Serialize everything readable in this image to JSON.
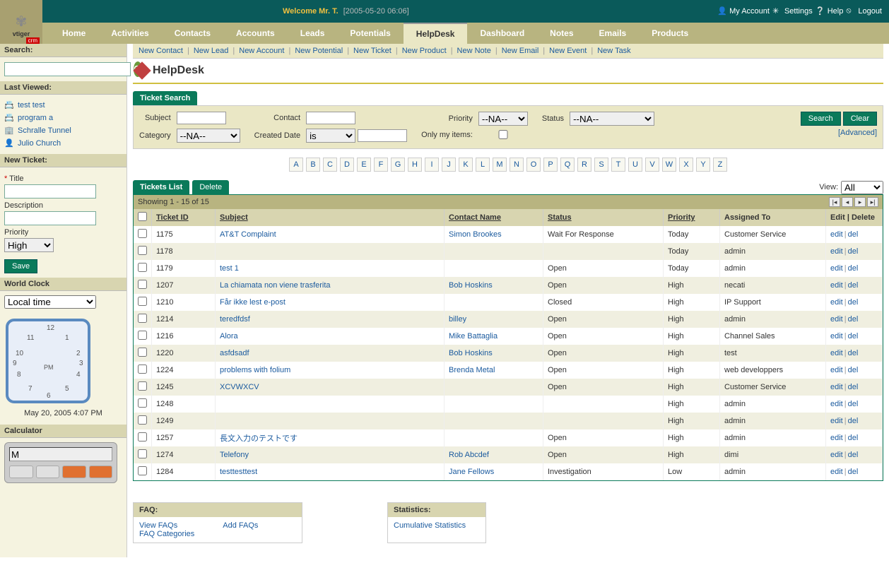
{
  "header": {
    "welcome": "Welcome Mr. T.",
    "timestamp": "[2005-05-20 06:06]",
    "links": {
      "account": "My Account",
      "settings": "Settings",
      "help": "Help",
      "logout": "Logout"
    }
  },
  "nav": [
    "Home",
    "Activities",
    "Contacts",
    "Accounts",
    "Leads",
    "Potentials",
    "HelpDesk",
    "Dashboard",
    "Notes",
    "Emails",
    "Products"
  ],
  "nav_active": "HelpDesk",
  "subnav": [
    "New Contact",
    "New Lead",
    "New Account",
    "New Potential",
    "New Ticket",
    "New Product",
    "New Note",
    "New Email",
    "New Event",
    "New Task"
  ],
  "page_title": "HelpDesk",
  "sidebar": {
    "search_label": "Search:",
    "last_viewed_label": "Last Viewed:",
    "last_viewed": [
      "test test",
      "program a",
      "Schralle Tunnel",
      "Julio Church"
    ],
    "new_ticket_label": "New Ticket:",
    "nt_title": "Title",
    "nt_desc": "Description",
    "nt_priority": "Priority",
    "nt_priority_val": "High",
    "save": "Save",
    "world_clock": "World Clock",
    "wc_option": "Local time",
    "wc_date": "May 20, 2005 4:07 PM",
    "calculator": "Calculator",
    "calc_val": "M"
  },
  "search": {
    "tab": "Ticket Search",
    "subject": "Subject",
    "contact": "Contact",
    "priority": "Priority",
    "status": "Status",
    "category": "Category",
    "created": "Created Date",
    "only_my": "Only my items:",
    "na": "--NA--",
    "is": "is",
    "search_btn": "Search",
    "clear_btn": "Clear",
    "advanced": "Advanced"
  },
  "alpha": [
    "A",
    "B",
    "C",
    "D",
    "E",
    "F",
    "G",
    "H",
    "I",
    "J",
    "K",
    "L",
    "M",
    "N",
    "O",
    "P",
    "Q",
    "R",
    "S",
    "T",
    "U",
    "V",
    "W",
    "X",
    "Y",
    "Z"
  ],
  "list": {
    "tab": "Tickets List",
    "delete": "Delete",
    "view_label": "View:",
    "view_val": "All",
    "showing": "Showing 1 - 15 of 15",
    "cols": {
      "id": "Ticket ID",
      "subject": "Subject",
      "contact": "Contact Name",
      "status": "Status",
      "priority": "Priority",
      "assigned": "Assigned To",
      "actions": "Edit | Delete"
    },
    "edit": "edit",
    "del": "del"
  },
  "tickets": [
    {
      "id": "1175",
      "subject": "AT&T Complaint",
      "contact": "Simon Brookes",
      "status": "Wait For Response",
      "priority": "Today",
      "assigned": "Customer Service"
    },
    {
      "id": "1178",
      "subject": "",
      "contact": "",
      "status": "",
      "priority": "Today",
      "assigned": "admin"
    },
    {
      "id": "1179",
      "subject": "test 1",
      "contact": "",
      "status": "Open",
      "priority": "Today",
      "assigned": "admin"
    },
    {
      "id": "1207",
      "subject": "La chiamata non viene trasferita",
      "contact": "Bob Hoskins",
      "status": "Open",
      "priority": "High",
      "assigned": "necati"
    },
    {
      "id": "1210",
      "subject": "Får ikke lest e-post",
      "contact": "",
      "status": "Closed",
      "priority": "High",
      "assigned": "IP Support"
    },
    {
      "id": "1214",
      "subject": "teredfdsf",
      "contact": "billey",
      "status": "Open",
      "priority": "High",
      "assigned": "admin"
    },
    {
      "id": "1216",
      "subject": "Alora",
      "contact": "Mike Battaglia",
      "status": "Open",
      "priority": "High",
      "assigned": "Channel Sales"
    },
    {
      "id": "1220",
      "subject": "asfdsadf",
      "contact": "Bob Hoskins",
      "status": "Open",
      "priority": "High",
      "assigned": "test"
    },
    {
      "id": "1224",
      "subject": "problems with folium",
      "contact": "Brenda Metal",
      "status": "Open",
      "priority": "High",
      "assigned": "web developpers"
    },
    {
      "id": "1245",
      "subject": "XCVWXCV",
      "contact": "",
      "status": "Open",
      "priority": "High",
      "assigned": "Customer Service"
    },
    {
      "id": "1248",
      "subject": "",
      "contact": "",
      "status": "",
      "priority": "High",
      "assigned": "admin"
    },
    {
      "id": "1249",
      "subject": "",
      "contact": "",
      "status": "",
      "priority": "High",
      "assigned": "admin"
    },
    {
      "id": "1257",
      "subject": "長文入力のテストです",
      "contact": "",
      "status": "Open",
      "priority": "High",
      "assigned": "admin"
    },
    {
      "id": "1274",
      "subject": "Telefony",
      "contact": "Rob Abcdef",
      "status": "Open",
      "priority": "High",
      "assigned": "dimi"
    },
    {
      "id": "1284",
      "subject": "testtesttest",
      "contact": "Jane Fellows",
      "status": "Investigation",
      "priority": "Low",
      "assigned": "admin"
    }
  ],
  "faq": {
    "title": "FAQ:",
    "view": "View FAQs",
    "add": "Add FAQs",
    "cat": "FAQ Categories"
  },
  "stats": {
    "title": "Statistics:",
    "cum": "Cumulative Statistics"
  }
}
